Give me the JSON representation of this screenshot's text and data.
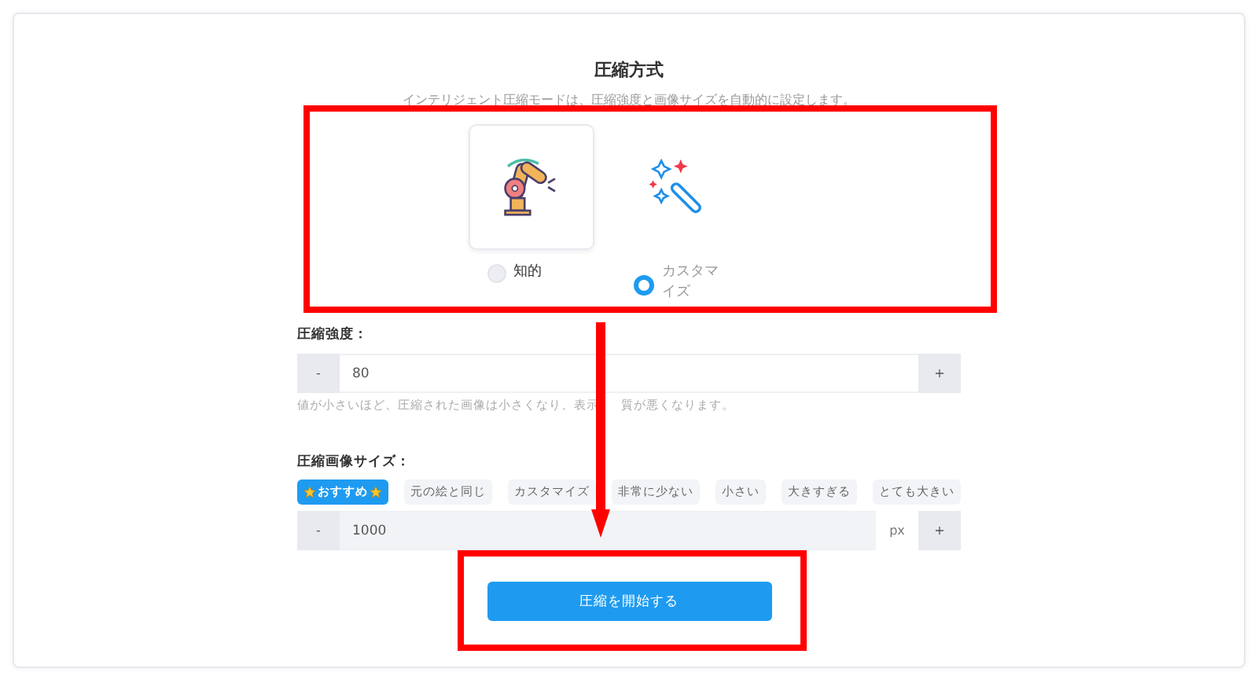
{
  "title": "圧縮方式",
  "subtitle": "インテリジェント圧縮モードは、圧縮強度と画像サイズを自動的に設定します。",
  "modes": [
    {
      "kind": "robot",
      "label": "知的",
      "selected": false
    },
    {
      "kind": "wand",
      "label": "カスタマイズ",
      "selected": true
    }
  ],
  "strength": {
    "label": "圧縮強度：",
    "minus": "-",
    "value": "80",
    "plus": "+",
    "hint": [
      "値が小さいほど、圧縮された画像は小さくなり、表示",
      "質が悪くなります。"
    ]
  },
  "size": {
    "label": "圧縮画像サイズ：",
    "presets": [
      {
        "label": "おすすめ",
        "starred": true,
        "selected": true
      },
      {
        "label": "元の絵と同じ",
        "starred": false,
        "selected": false
      },
      {
        "label": "カスタマイズ",
        "starred": false,
        "selected": false
      },
      {
        "label": "非常に少ない",
        "starred": false,
        "selected": false
      },
      {
        "label": "小さい",
        "starred": false,
        "selected": false
      },
      {
        "label": "大きすぎる",
        "starred": false,
        "selected": false
      },
      {
        "label": "とても大きい",
        "starred": false,
        "selected": false
      }
    ],
    "minus": "-",
    "value": "1000",
    "unit": "px",
    "plus": "+"
  },
  "start_button": "圧縮を開始する"
}
